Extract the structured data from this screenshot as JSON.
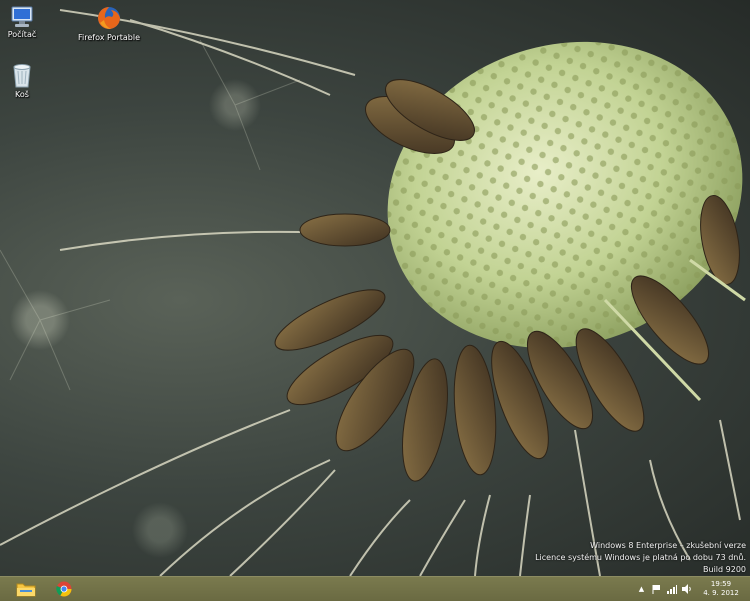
{
  "desktop": {
    "icons": [
      {
        "label": "Počítač",
        "icon": "computer-icon"
      },
      {
        "label": "Firefox Portable",
        "icon": "firefox-icon"
      },
      {
        "label": "Koš",
        "icon": "recycle-bin-icon"
      }
    ]
  },
  "watermark": {
    "line1": "Windows 8 Enterprise – zkušební verze",
    "line2": "Licence systému Windows je platná po dobu 73 dnů.",
    "line3": "Build 9200"
  },
  "taskbar": {
    "pinned": [
      {
        "name": "file-explorer",
        "icon": "folder-icon"
      },
      {
        "name": "chrome",
        "icon": "chrome-icon"
      }
    ],
    "tray": {
      "show_hidden_label": "▲",
      "icons": [
        "flag-icon",
        "network-icon",
        "volume-icon"
      ]
    },
    "clock": {
      "time": "19:59",
      "date": "4. 9. 2012"
    }
  },
  "colors": {
    "taskbar": "#6f6f46",
    "seed_head": "#b7c98a",
    "seed_dark": "#5a4a2c"
  }
}
